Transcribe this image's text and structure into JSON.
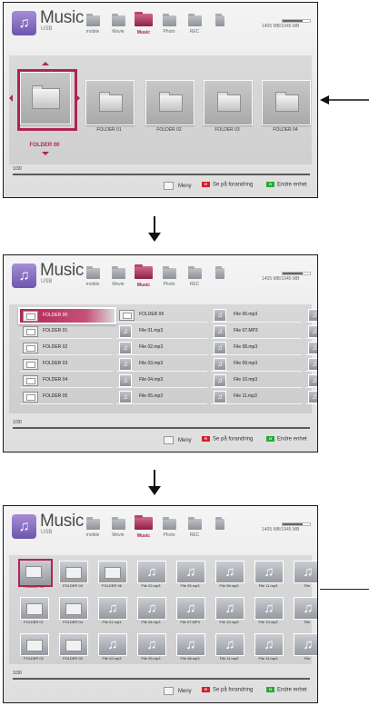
{
  "header": {
    "title": "Music",
    "subtitle": "USB",
    "capacity": "1405 MB/1945 MB",
    "capacity_fraction": 0.72,
    "categories": [
      {
        "label": "mobile"
      },
      {
        "label": "Movie"
      },
      {
        "label": "Music"
      },
      {
        "label": "Photo"
      },
      {
        "label": "REC"
      },
      {
        "label": ""
      }
    ]
  },
  "footer": {
    "page": "1/30",
    "menu_label": "Meny",
    "red_label": "Se på forandring",
    "green_label": "Endre enhet",
    "red_key": "R",
    "green_key": "G"
  },
  "screen1": {
    "folders": [
      "FOLDER 00",
      "FOLDER 01",
      "FOLDER 02",
      "FOLDER 03",
      "FOLDER 04"
    ]
  },
  "screen2": {
    "col1": [
      "FOLDER 00",
      "FOLDER 01",
      "FOLDER 02",
      "FOLDER 03",
      "FOLDER 04",
      "FOLDER 05"
    ],
    "col2": [
      "FOLDER 06",
      "File 01.mp3",
      "File 02.mp3",
      "File 03.mp3",
      "File 04.mp3",
      "File 05.mp3"
    ],
    "col3": [
      "File 06.mp3",
      "File 07.MP3",
      "File 08.mp3",
      "File 09.mp3",
      "File 10.mp3",
      "File 11.mp3"
    ]
  },
  "screen3": {
    "rows": [
      [
        "FOLDER 00",
        "FOLDER 03",
        "FOLDER 06",
        "File 02.mp3",
        "File 05.mp3",
        "File 08.mp3",
        "File 11.mp3",
        "File"
      ],
      [
        "FOLDER 01",
        "FOLDER 04",
        "File 01.mp3",
        "File 04.mp3",
        "File 07.MP3",
        "File 10.mp3",
        "File 13.mp3",
        "File"
      ],
      [
        "FOLDER 02",
        "FOLDER 05",
        "File 02.mp3",
        "File 05.mp3",
        "File 08.mp3",
        "File 11.mp3",
        "File 14.mp3",
        "File"
      ]
    ]
  },
  "colors": {
    "accent": "#b0264f",
    "red": "#d1202b",
    "green": "#2aa637",
    "purple": "#7a62b8"
  },
  "icons": [
    "music-note-icon",
    "folder-icon",
    "arrow-down-icon",
    "arrow-left-icon"
  ]
}
